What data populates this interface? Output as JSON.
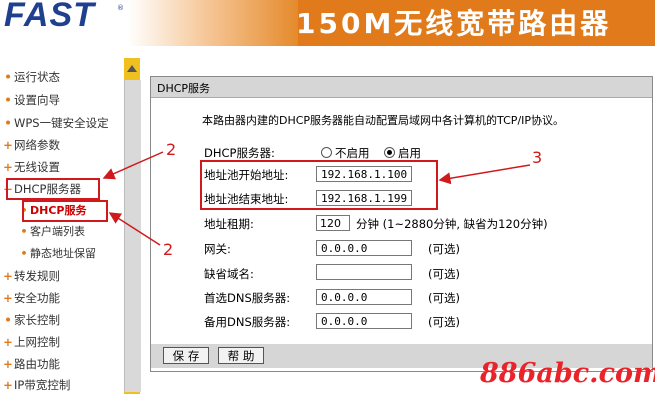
{
  "header": {
    "logo": "FAST",
    "logo_mark": "®",
    "title": "150M无线宽带路由器"
  },
  "sidebar": {
    "items": [
      {
        "label": "运行状态",
        "bullet": "•"
      },
      {
        "label": "设置向导",
        "bullet": "•"
      },
      {
        "label": "WPS一键安全设定",
        "bullet": "•"
      },
      {
        "label": "网络参数",
        "bullet": "+"
      },
      {
        "label": "无线设置",
        "bullet": "+"
      },
      {
        "label": "DHCP服务器",
        "bullet": "−"
      },
      {
        "label": "DHCP服务",
        "bullet": "•"
      },
      {
        "label": "客户端列表",
        "bullet": "•"
      },
      {
        "label": "静态地址保留",
        "bullet": "•"
      },
      {
        "label": "转发规则",
        "bullet": "+"
      },
      {
        "label": "安全功能",
        "bullet": "+"
      },
      {
        "label": "家长控制",
        "bullet": "•"
      },
      {
        "label": "上网控制",
        "bullet": "+"
      },
      {
        "label": "路由功能",
        "bullet": "+"
      },
      {
        "label": "IP带宽控制",
        "bullet": "+"
      }
    ]
  },
  "panel": {
    "title": "DHCP服务",
    "description": "本路由器内建的DHCP服务器能自动配置局域网中各计算机的TCP/IP协议。",
    "dhcp_server_label": "DHCP服务器:",
    "disable_label": "不启用",
    "enable_label": "启用",
    "dhcp_enabled": true,
    "start_label": "地址池开始地址:",
    "start_value": "192.168.1.100",
    "end_label": "地址池结束地址:",
    "end_value": "192.168.1.199",
    "lease_label": "地址租期:",
    "lease_value": "120",
    "lease_unit": "分钟",
    "lease_note": "(1~2880分钟, 缺省为120分钟)",
    "gateway_label": "网关:",
    "gateway_value": "0.0.0.0",
    "domain_label": "缺省域名:",
    "domain_value": "",
    "dns1_label": "首选DNS服务器:",
    "dns1_value": "0.0.0.0",
    "dns2_label": "备用DNS服务器:",
    "dns2_value": "0.0.0.0",
    "optional_note": "(可选)",
    "save_label": "保 存",
    "help_label": "帮 助"
  },
  "annotations": {
    "num_sidebar": "2",
    "num_sub": "2",
    "num_fields": "3",
    "color": "#d0191c"
  },
  "watermark": "886abc.com"
}
